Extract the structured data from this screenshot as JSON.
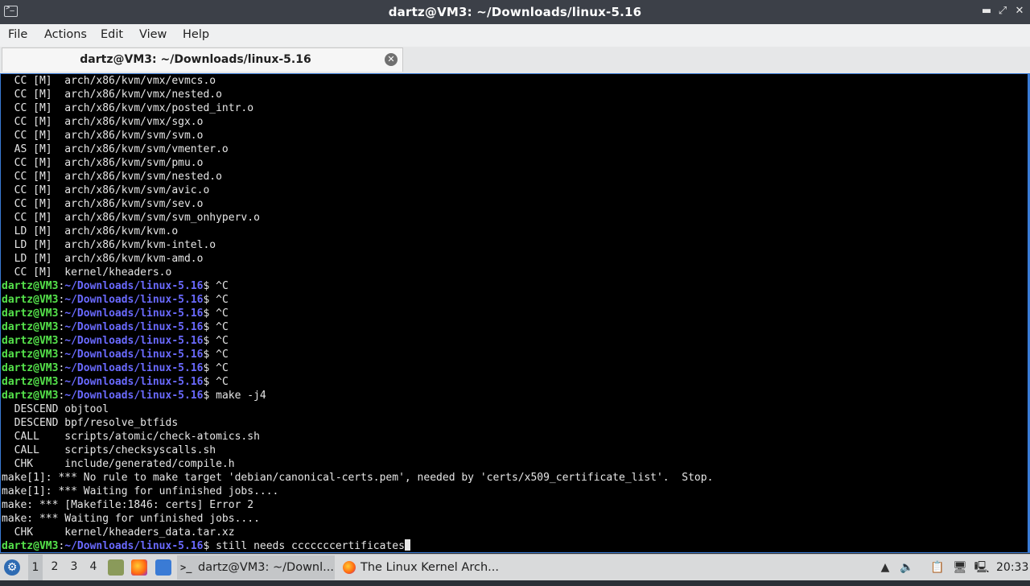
{
  "window": {
    "title": "dartz@VM3: ~/Downloads/linux-5.16",
    "controls": {
      "minimize": "▬",
      "maximize": "⤢",
      "close": "✕"
    }
  },
  "menu": [
    "File",
    "Actions",
    "Edit",
    "View",
    "Help"
  ],
  "tab": {
    "label": "dartz@VM3: ~/Downloads/linux-5.16",
    "close": "✕"
  },
  "terminal": {
    "prompt_user": "dartz@VM3",
    "prompt_path": "~/Downloads/linux-5.16",
    "lines": [
      {
        "text": "  CC [M]  arch/x86/kvm/vmx/evmcs.o"
      },
      {
        "text": "  CC [M]  arch/x86/kvm/vmx/nested.o"
      },
      {
        "text": "  CC [M]  arch/x86/kvm/vmx/posted_intr.o"
      },
      {
        "text": "  CC [M]  arch/x86/kvm/vmx/sgx.o"
      },
      {
        "text": "  CC [M]  arch/x86/kvm/svm/svm.o"
      },
      {
        "text": "  AS [M]  arch/x86/kvm/svm/vmenter.o"
      },
      {
        "text": "  CC [M]  arch/x86/kvm/svm/pmu.o"
      },
      {
        "text": "  CC [M]  arch/x86/kvm/svm/nested.o"
      },
      {
        "text": "  CC [M]  arch/x86/kvm/svm/avic.o"
      },
      {
        "text": "  CC [M]  arch/x86/kvm/svm/sev.o"
      },
      {
        "text": "  CC [M]  arch/x86/kvm/svm/svm_onhyperv.o"
      },
      {
        "text": "  LD [M]  arch/x86/kvm/kvm.o"
      },
      {
        "text": "  LD [M]  arch/x86/kvm/kvm-intel.o"
      },
      {
        "text": "  LD [M]  arch/x86/kvm/kvm-amd.o"
      },
      {
        "text": "  CC [M]  kernel/kheaders.o"
      },
      {
        "prompt": true,
        "cmd": "$ ^C"
      },
      {
        "prompt": true,
        "cmd": "$ ^C"
      },
      {
        "prompt": true,
        "cmd": "$ ^C"
      },
      {
        "prompt": true,
        "cmd": "$ ^C"
      },
      {
        "prompt": true,
        "cmd": "$ ^C"
      },
      {
        "prompt": true,
        "cmd": "$ ^C"
      },
      {
        "prompt": true,
        "cmd": "$ ^C"
      },
      {
        "prompt": true,
        "cmd": "$ ^C"
      },
      {
        "prompt": true,
        "cmd": "$ make -j4"
      },
      {
        "text": "  DESCEND objtool"
      },
      {
        "text": "  DESCEND bpf/resolve_btfids"
      },
      {
        "text": "  CALL    scripts/atomic/check-atomics.sh"
      },
      {
        "text": "  CALL    scripts/checksyscalls.sh"
      },
      {
        "text": "  CHK     include/generated/compile.h"
      },
      {
        "text": "make[1]: *** No rule to make target 'debian/canonical-certs.pem', needed by 'certs/x509_certificate_list'.  Stop."
      },
      {
        "text": "make[1]: *** Waiting for unfinished jobs...."
      },
      {
        "text": "make: *** [Makefile:1846: certs] Error 2"
      },
      {
        "text": "make: *** Waiting for unfinished jobs...."
      },
      {
        "text": "  CHK     kernel/kheaders_data.tar.xz"
      },
      {
        "prompt": true,
        "cmd": "$ still needs cccccccertificates",
        "cursor": true
      }
    ]
  },
  "taskbar": {
    "start_icon": "start-menu-icon",
    "workspaces": [
      "1",
      "2",
      "3",
      "4"
    ],
    "active_workspace": "1",
    "tasks": [
      {
        "label": "dartz@VM3: ~/Downl...",
        "icon": "terminal-icon",
        "active": true
      },
      {
        "label": "The Linux Kernel Arch...",
        "icon": "firefox-icon",
        "active": false
      }
    ],
    "clock": "20:33",
    "colors": {
      "accent": "#3a7bd5",
      "prompt_user": "#55e34b",
      "prompt_path": "#6a6aff"
    }
  }
}
